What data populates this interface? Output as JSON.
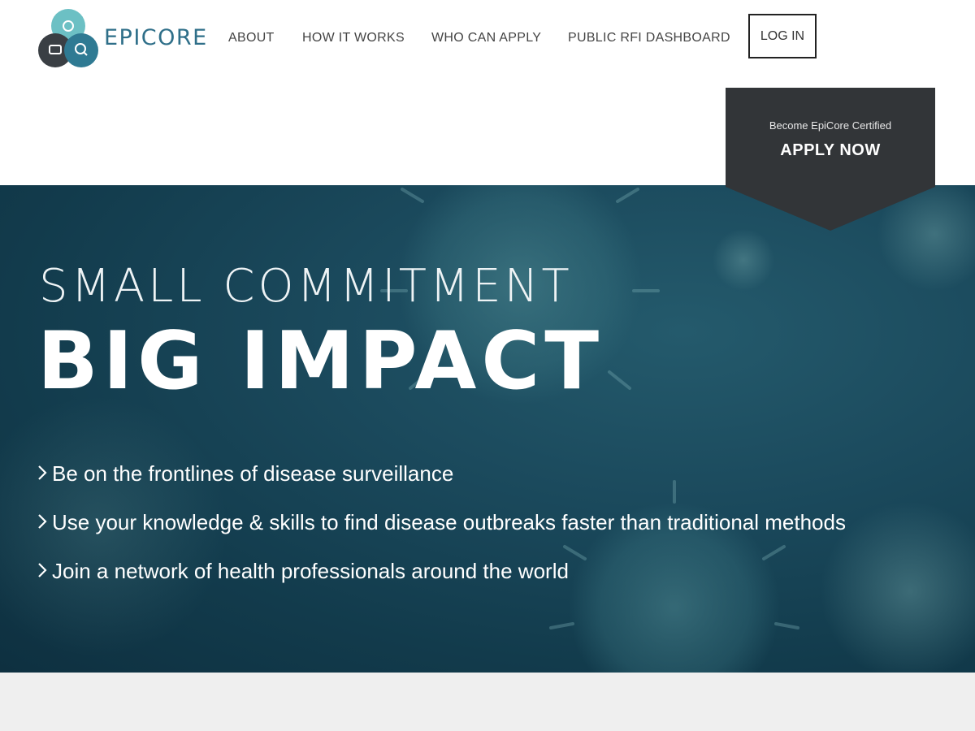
{
  "brand": {
    "name": "EPICORE"
  },
  "nav": {
    "items": [
      {
        "label": "ABOUT"
      },
      {
        "label": "HOW IT WORKS"
      },
      {
        "label": "WHO CAN APPLY"
      },
      {
        "label": "PUBLIC RFI DASHBOARD"
      }
    ],
    "login_label": "LOG IN"
  },
  "apply_banner": {
    "small_text": "Become EpiCore Certified",
    "button_label": "APPLY NOW"
  },
  "hero": {
    "headline_line1": "SMALL COMMITMENT",
    "headline_line2": "BIG IMPACT",
    "bullets": [
      {
        "icon": "chevron-right-icon",
        "text": "Be on the frontlines of disease surveillance"
      },
      {
        "icon": "chevron-right-icon",
        "text": "Use your knowledge & skills to find disease outbreaks faster than traditional methods"
      },
      {
        "icon": "chevron-right-icon",
        "text": "Join a network of health professionals around the world"
      }
    ]
  },
  "colors": {
    "brand_teal": "#2f6f89",
    "logo_light_teal": "#6cc0c4",
    "logo_dark": "#3a3f44",
    "banner_dark": "#323538",
    "hero_bg": "#1b4a5d",
    "footer_band": "#efefef"
  }
}
